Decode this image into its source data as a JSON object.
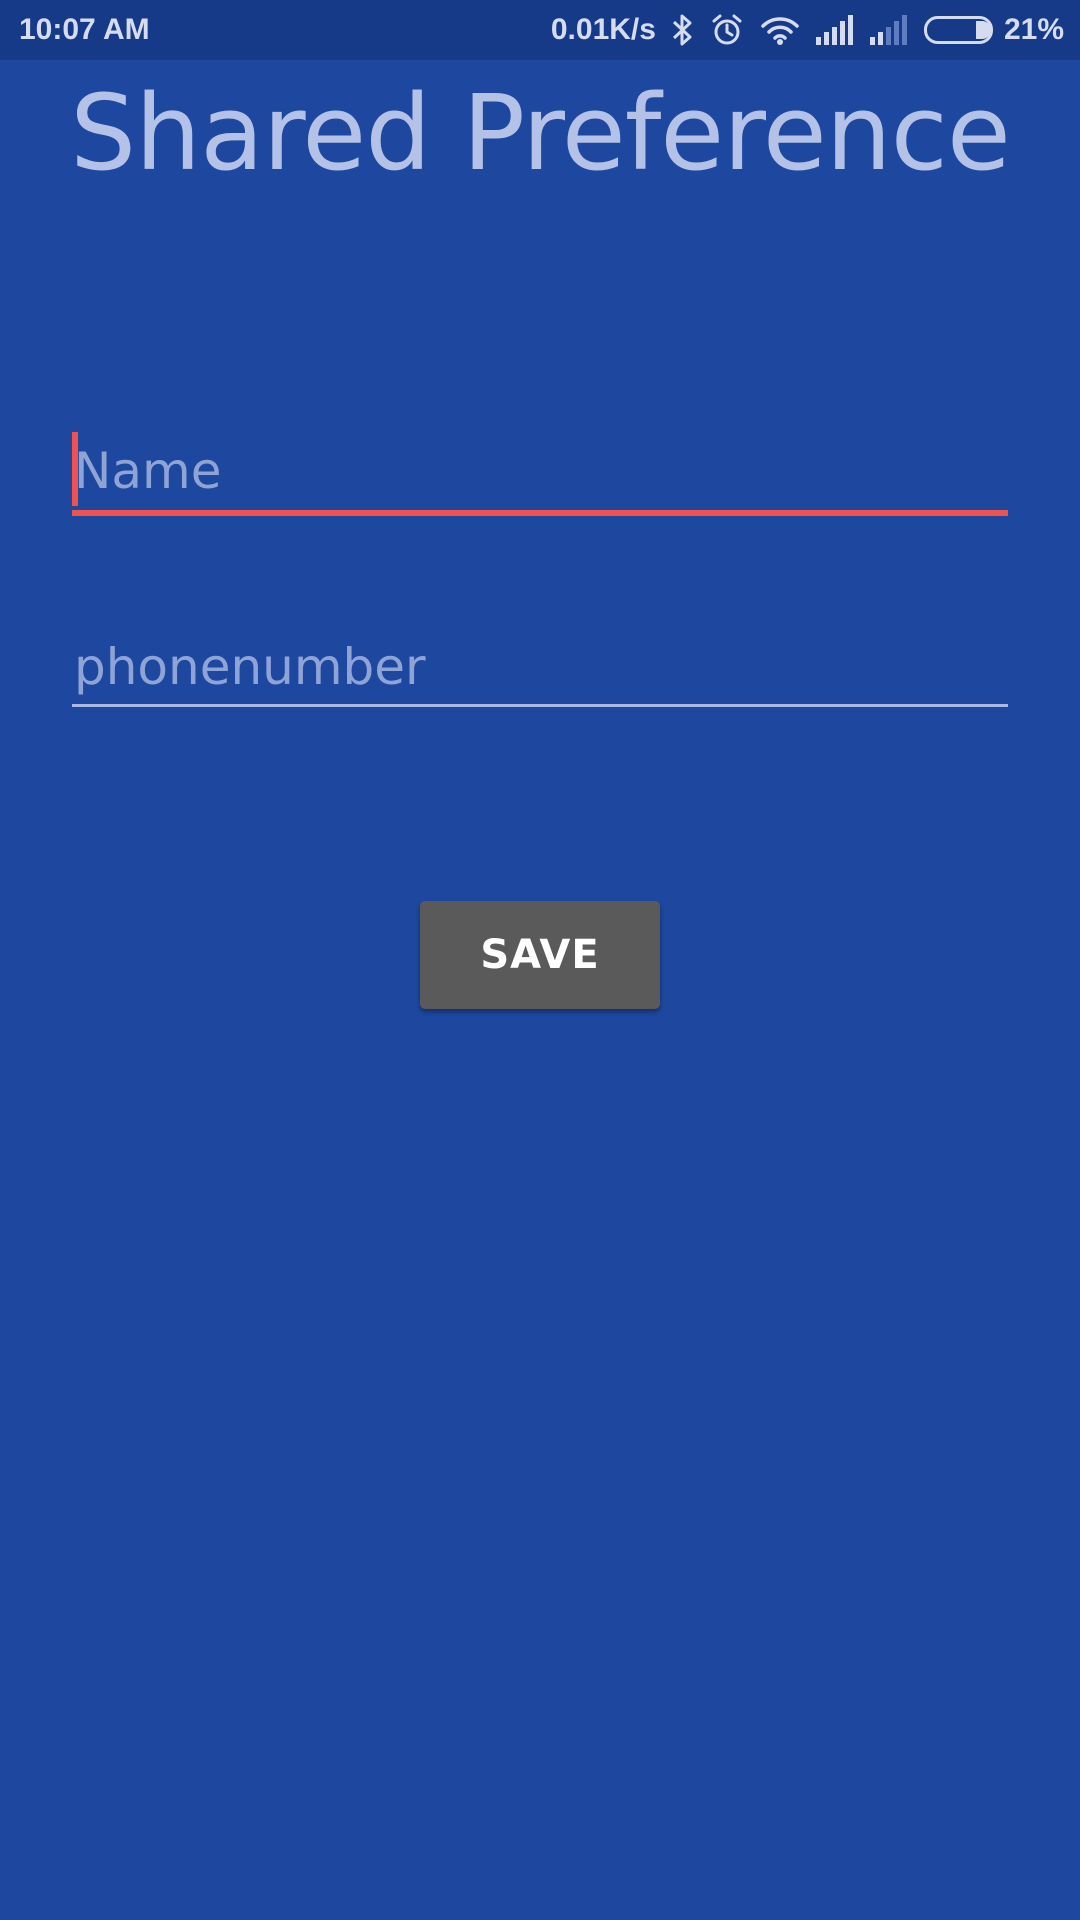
{
  "status_bar": {
    "time": "10:07 AM",
    "net_speed": "0.01K/s",
    "battery_percent": "21%",
    "battery_level": 0.21,
    "icons": [
      "bluetooth-icon",
      "alarm-icon",
      "wifi-icon",
      "signal-icon",
      "signal-weak-icon",
      "battery-icon"
    ]
  },
  "page": {
    "title": "Shared Preference"
  },
  "form": {
    "name": {
      "value": "",
      "placeholder": "Name",
      "focused": true
    },
    "phone": {
      "value": "",
      "placeholder": "phonenumber",
      "focused": false
    },
    "save_label": "SAVE"
  },
  "colors": {
    "background": "#1e47a0",
    "status_bar": "#173a88",
    "accent": "#ef5350",
    "button": "#5a5a5a",
    "title_text": "#b3c2e6"
  }
}
